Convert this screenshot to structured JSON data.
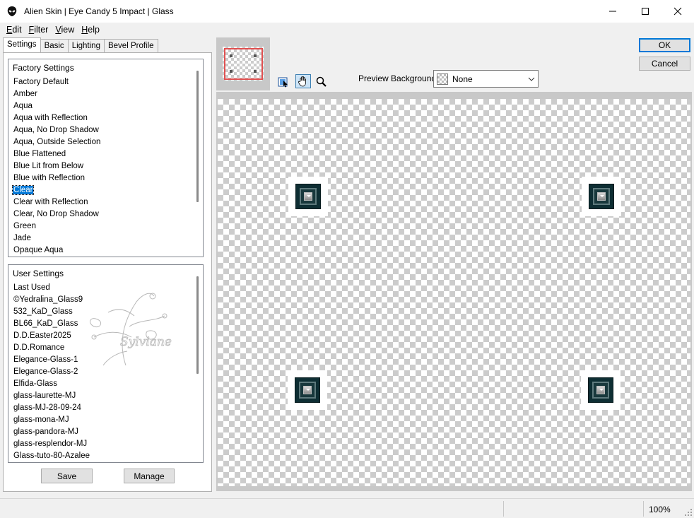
{
  "window": {
    "title": "Alien Skin | Eye Candy 5 Impact | Glass",
    "controls": [
      "minimize-icon",
      "maximize-icon",
      "close-icon"
    ]
  },
  "menu": [
    {
      "accel": "E",
      "rest": "dit"
    },
    {
      "accel": "F",
      "rest": "ilter"
    },
    {
      "accel": "V",
      "rest": "iew"
    },
    {
      "accel": "H",
      "rest": "elp"
    }
  ],
  "tabs": [
    "Settings",
    "Basic",
    "Lighting",
    "Bevel Profile"
  ],
  "factory": {
    "header": "Factory Settings",
    "items": [
      "Factory Default",
      "Amber",
      "Aqua",
      "Aqua with Reflection",
      "Aqua, No Drop Shadow",
      "Aqua, Outside Selection",
      "Blue Flattened",
      "Blue Lit from Below",
      "Blue with Reflection",
      "Clear",
      "Clear with Reflection",
      "Clear, No Drop Shadow",
      "Green",
      "Jade",
      "Opaque Aqua"
    ],
    "selected": "Clear"
  },
  "user": {
    "header": "User Settings",
    "items": [
      "Last Used",
      "©Yedralina_Glass9",
      "532_KaD_Glass",
      "BL66_KaD_Glass",
      "D.D.Easter2025",
      "D.D.Romance",
      "Elegance-Glass-1",
      "Elegance-Glass-2",
      "Elfida-Glass",
      "glass-laurette-MJ",
      "glass-MJ-28-09-24",
      "glass-mona-MJ",
      "glass-pandora-MJ",
      "glass-resplendor-MJ",
      "Glass-tuto-80-Azalee"
    ]
  },
  "watermark": {
    "text": "Sylviane"
  },
  "buttons": {
    "save": "Save",
    "manage": "Manage",
    "ok": "OK",
    "cancel": "Cancel"
  },
  "preview_background": {
    "label": "Preview Background:",
    "value": "None"
  },
  "tools": [
    "navigate-preview-icon",
    "hand-icon",
    "zoom-icon"
  ],
  "status": {
    "zoom": "100%"
  },
  "colors": {
    "selection": "#0078d7",
    "glass_dark": "#0e2e33",
    "nav_rect": "#e05050"
  }
}
